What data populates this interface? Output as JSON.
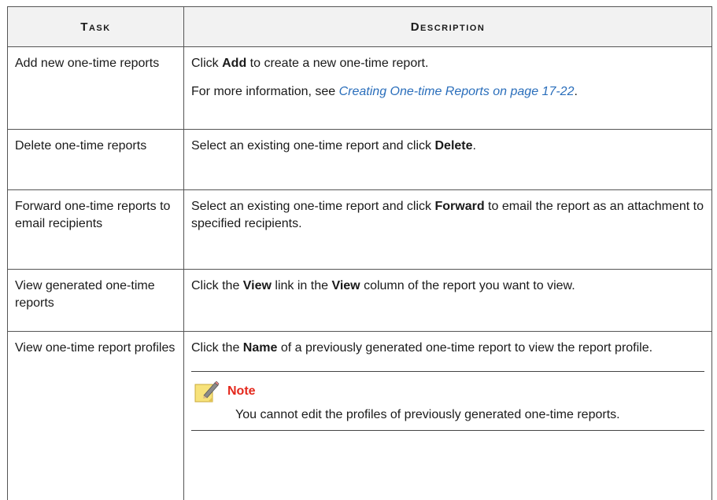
{
  "table": {
    "headers": {
      "task": "Task",
      "description": "Description"
    },
    "rows": [
      {
        "task": "Add new one-time reports",
        "desc": {
          "p1_pre": "Click ",
          "p1_bold": "Add",
          "p1_post": " to create a new one-time report.",
          "p2_pre": "For more information, see ",
          "p2_link": "Creating One-time Reports on page 17-22",
          "p2_post": "."
        }
      },
      {
        "task": "Delete one-time reports",
        "desc": {
          "pre": "Select an existing one-time report and click ",
          "bold": "Delete",
          "post": "."
        }
      },
      {
        "task": "Forward one-time reports to email recipients",
        "desc": {
          "pre": "Select an existing one-time report and click ",
          "bold": "Forward",
          "post": " to email the report as an attachment to specified recipients."
        }
      },
      {
        "task": "View generated one-time reports",
        "desc": {
          "pre": "Click the ",
          "bold1": "View",
          "mid": " link in the ",
          "bold2": "View",
          "post": " column of the report you want to view."
        }
      },
      {
        "task": "View one-time report profiles",
        "desc": {
          "pre": "Click the ",
          "bold": "Name",
          "post": " of a previously generated one-time report to view the report profile."
        },
        "note": {
          "title": "Note",
          "text": "You cannot edit the profiles of previously generated one-time reports.",
          "icon": "note-pencil-icon"
        }
      }
    ]
  }
}
